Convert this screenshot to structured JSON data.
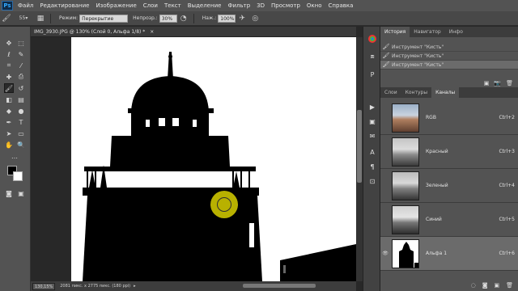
{
  "app": {
    "logo": "Ps"
  },
  "menu": [
    "Файл",
    "Редактирование",
    "Изображение",
    "Слои",
    "Текст",
    "Выделение",
    "Фильтр",
    "3D",
    "Просмотр",
    "Окно",
    "Справка"
  ],
  "options": {
    "brush_size": "55",
    "mode_label": "Режим:",
    "mode_value": "Перекрытие",
    "opacity_label": "Непрозр.:",
    "opacity_value": "30%",
    "pressure_label": "Наж.:",
    "pressure_value": "100%"
  },
  "document": {
    "tab_title": "IMG_3930.JPG @ 130% (Слой 0, Альфа 1/8) *",
    "close_glyph": "×"
  },
  "status": {
    "zoom": "130,15%",
    "doc_info": "2081 пикс. x 2775 пикс. (180 ppi)"
  },
  "panels": {
    "top_tabs": [
      "История",
      "Навигатор",
      "Инфо"
    ],
    "history_items": [
      "Инструмент \"Кисть\"",
      "Инструмент \"Кисть\"",
      "Инструмент \"Кисть\""
    ],
    "bottom_tabs": [
      "Слои",
      "Контуры",
      "Каналы"
    ],
    "channels": [
      {
        "name": "RGB",
        "shortcut": "Ctrl+2"
      },
      {
        "name": "Красный",
        "shortcut": "Ctrl+3"
      },
      {
        "name": "Зеленый",
        "shortcut": "Ctrl+4"
      },
      {
        "name": "Синий",
        "shortcut": "Ctrl+5"
      },
      {
        "name": "Альфа 1",
        "shortcut": "Ctrl+6"
      }
    ]
  },
  "colors": {
    "menubar": "#535353",
    "canvas": "#ffffff",
    "brush_cursor": "#c8c000"
  }
}
